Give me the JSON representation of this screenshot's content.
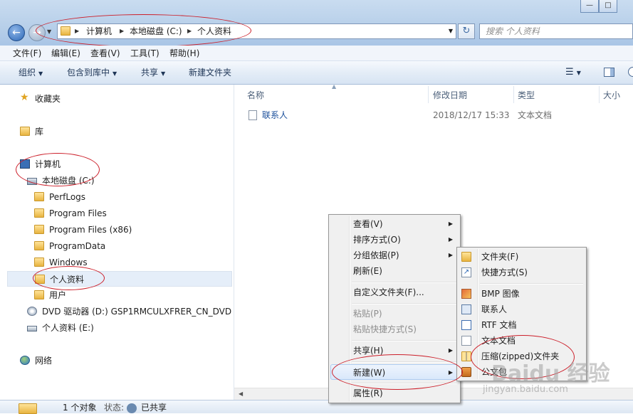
{
  "window": {
    "buttons": [
      "—",
      "□"
    ]
  },
  "address": {
    "crumbs": [
      "计算机",
      "本地磁盘 (C:)",
      "个人资料"
    ]
  },
  "search": {
    "placeholder": "搜索 个人资料"
  },
  "menubar": [
    "文件(F)",
    "编辑(E)",
    "查看(V)",
    "工具(T)",
    "帮助(H)"
  ],
  "toolbar": {
    "organize": "组织",
    "include_library": "包含到库中",
    "share": "共享",
    "new_folder": "新建文件夹"
  },
  "nav": {
    "favorites": "收藏夹",
    "libraries": "库",
    "computer": "计算机",
    "local_disk": "本地磁盘 (C:)",
    "folders": [
      "PerfLogs",
      "Program Files",
      "Program Files (x86)",
      "ProgramData",
      "Windows",
      "个人资料",
      "用户"
    ],
    "dvd": "DVD 驱动器 (D:) GSP1RMCULXFRER_CN_DVD",
    "e_drive": "个人资料 (E:)",
    "network": "网络"
  },
  "columns": {
    "name": "名称",
    "modified": "修改日期",
    "type": "类型",
    "size": "大小"
  },
  "files": [
    {
      "name": "联系人",
      "modified": "2018/12/17 15:33",
      "type": "文本文档"
    }
  ],
  "status": {
    "count": "1 个对象",
    "state_label": "状态:",
    "state": "已共享"
  },
  "context_menu": {
    "view": "查看(V)",
    "sort": "排序方式(O)",
    "group": "分组依据(P)",
    "refresh": "刷新(E)",
    "customize": "自定义文件夹(F)...",
    "paste": "粘贴(P)",
    "paste_shortcut": "粘贴快捷方式(S)",
    "share": "共享(H)",
    "new": "新建(W)",
    "properties": "属性(R)"
  },
  "new_submenu": {
    "folder": "文件夹(F)",
    "shortcut": "快捷方式(S)",
    "bmp": "BMP 图像",
    "contact": "联系人",
    "rtf": "RTF 文档",
    "text": "文本文档",
    "zip": "压缩(zipped)文件夹",
    "briefcase": "公文包"
  },
  "watermark": {
    "logo": "Baidu 经验",
    "url": "jingyan.baidu.com"
  },
  "colors": {
    "annotation": "#cc1f2a",
    "accent": "#2c68b7"
  }
}
